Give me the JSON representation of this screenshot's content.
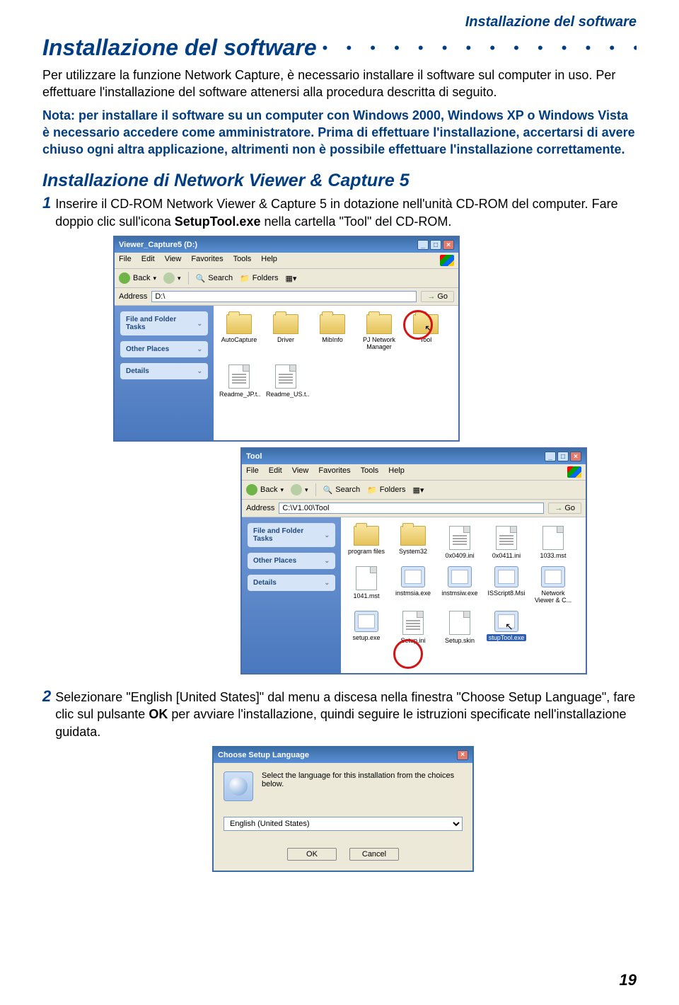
{
  "header_right": "Installazione del software",
  "title": "Installazione del software",
  "para1": "Per utilizzare la funzione Network Capture, è necessario installare il software sul computer in uso. Per effettuare l'installazione del software attenersi alla procedura descritta di seguito.",
  "note": "Nota: per installare il software su un computer con Windows 2000, Windows XP o Windows Vista è necessario accedere come amministratore. Prima di effettuare l'installazione, accertarsi di avere chiuso ogni altra applicazione, altrimenti non è possibile effettuare l'installazione correttamente.",
  "sub_title": "Installazione di Network Viewer & Capture 5",
  "step1_num": "1",
  "step1_a": "Inserire il CD-ROM Network Viewer & Capture 5 in dotazione nell'unità CD-ROM del computer. Fare doppio clic sull'icona ",
  "step1_b": "SetupTool.exe",
  "step1_c": " nella cartella \"Tool\" del CD-ROM.",
  "step2_num": "2",
  "step2_a": "Selezionare \"English [United States]\" dal menu a discesa nella finestra \"Choose Setup Language\", fare clic sul pulsante ",
  "step2_b": "OK",
  "step2_c": " per avviare l'installazione, quindi seguire le istruzioni specificate nell'installazione guidata.",
  "page_number": "19",
  "win": {
    "menu": {
      "file": "File",
      "edit": "Edit",
      "view": "View",
      "favorites": "Favorites",
      "tools": "Tools",
      "help": "Help"
    },
    "toolbar": {
      "back": "Back",
      "search": "Search",
      "folders": "Folders"
    },
    "address_label": "Address",
    "go": "Go",
    "side": {
      "tasks": "File and Folder Tasks",
      "other": "Other Places",
      "details": "Details"
    }
  },
  "win1": {
    "title": "Viewer_Capture5 (D:)",
    "address": "D:\\",
    "items": [
      "AutoCapture",
      "Driver",
      "MibInfo",
      "PJ Network Manager",
      "Tool",
      "Readme_JP.t..",
      "Readme_US.t.."
    ]
  },
  "win2": {
    "title": "Tool",
    "address": "C:\\V1.00\\Tool",
    "items": [
      "program files",
      "System32",
      "0x0409.ini",
      "0x0411.ini",
      "1033.mst",
      "1041.mst",
      "instmsia.exe",
      "instmsiw.exe",
      "ISScript8.Msi",
      "Network Viewer & C...",
      "setup.exe",
      "Setup.ini",
      "Setup.skin",
      "stupTool.exe"
    ]
  },
  "dialog": {
    "title": "Choose Setup Language",
    "text": "Select the language for this installation from the choices below.",
    "option": "English (United States)",
    "ok": "OK",
    "cancel": "Cancel"
  }
}
